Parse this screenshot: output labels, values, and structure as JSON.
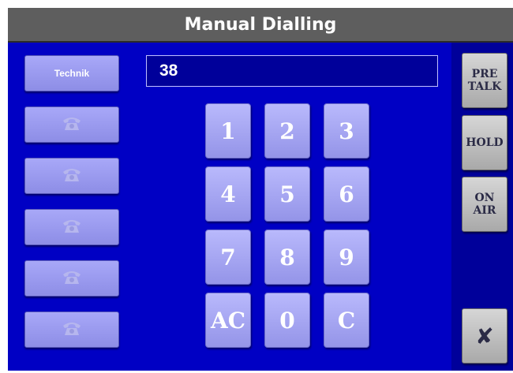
{
  "title": "Manual Dialling",
  "number_display": {
    "value": "38"
  },
  "contacts": [
    {
      "label": "Technik",
      "icon": ""
    },
    {
      "label": "",
      "icon": "telephone-icon"
    },
    {
      "label": "",
      "icon": "telephone-icon"
    },
    {
      "label": "",
      "icon": "telephone-icon"
    },
    {
      "label": "",
      "icon": "telephone-icon"
    },
    {
      "label": "",
      "icon": "telephone-icon"
    }
  ],
  "keypad": {
    "k1": "1",
    "k2": "2",
    "k3": "3",
    "k4": "4",
    "k5": "5",
    "k6": "6",
    "k7": "7",
    "k8": "8",
    "k9": "9",
    "kAC": "AC",
    "k0": "0",
    "kC": "C"
  },
  "side_buttons": {
    "pre_talk": "PRE\nTALK",
    "hold": "HOLD",
    "on_air": "ON\nAIR",
    "close": "✘"
  },
  "colors": {
    "background": "#0000c4",
    "title_bar": "#5e5e5e",
    "right_panel": "#00009a",
    "key": "#a8a8f8",
    "side_button": "#c0c0c0"
  }
}
